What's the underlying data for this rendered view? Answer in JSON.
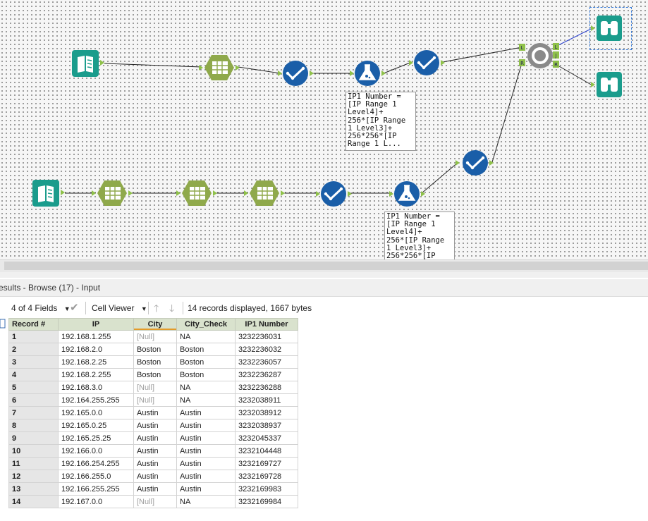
{
  "canvas": {
    "annotations": [
      "IP1 Number =\n[IP Range 1\nLevel4]+\n256*[IP Range\n1 Level3]+\n256*256*[IP\nRange 1 L...",
      "IP1 Number =\n[IP Range 1\nLevel4]+\n256*[IP Range\n1 Level3]+\n256*256*[IP"
    ],
    "join_anchors": {
      "left": "L",
      "right": "R",
      "j": "J",
      "l_out": "L",
      "r_out": "R"
    },
    "selection_color": "#3b7dd8",
    "tool_colors": {
      "input": "#1a9c8c",
      "text_to_columns": "#8fa94b",
      "select": "#1a5ea8",
      "formula": "#1a5ea8",
      "join": "#8a8a8a",
      "browse": "#1a9c8c"
    }
  },
  "results": {
    "title": "esults - Browse (17) - Input",
    "fields_label": "4 of 4 Fields",
    "viewer_label": "Cell Viewer",
    "status": "14 records displayed, 1667 bytes",
    "columns": [
      "Record #",
      "IP",
      "City",
      "City_Check",
      "IP1 Number"
    ],
    "rows": [
      [
        "1",
        "192.168.1.255",
        "[Null]",
        "NA",
        "3232236031"
      ],
      [
        "2",
        "192.168.2.0",
        "Boston",
        "Boston",
        "3232236032"
      ],
      [
        "3",
        "192.168.2.25",
        "Boston",
        "Boston",
        "3232236057"
      ],
      [
        "4",
        "192.168.2.255",
        "Boston",
        "Boston",
        "3232236287"
      ],
      [
        "5",
        "192.168.3.0",
        "[Null]",
        "NA",
        "3232236288"
      ],
      [
        "6",
        "192.164.255.255",
        "[Null]",
        "NA",
        "3232038911"
      ],
      [
        "7",
        "192.165.0.0",
        "Austin",
        "Austin",
        "3232038912"
      ],
      [
        "8",
        "192.165.0.25",
        "Austin",
        "Austin",
        "3232038937"
      ],
      [
        "9",
        "192.165.25.25",
        "Austin",
        "Austin",
        "3232045337"
      ],
      [
        "10",
        "192.166.0.0",
        "Austin",
        "Austin",
        "3232104448"
      ],
      [
        "11",
        "192.166.254.255",
        "Austin",
        "Austin",
        "3232169727"
      ],
      [
        "12",
        "192.166.255.0",
        "Austin",
        "Austin",
        "3232169728"
      ],
      [
        "13",
        "192.166.255.255",
        "Austin",
        "Austin",
        "3232169983"
      ],
      [
        "14",
        "192.167.0.0",
        "[Null]",
        "NA",
        "3232169984"
      ]
    ]
  }
}
